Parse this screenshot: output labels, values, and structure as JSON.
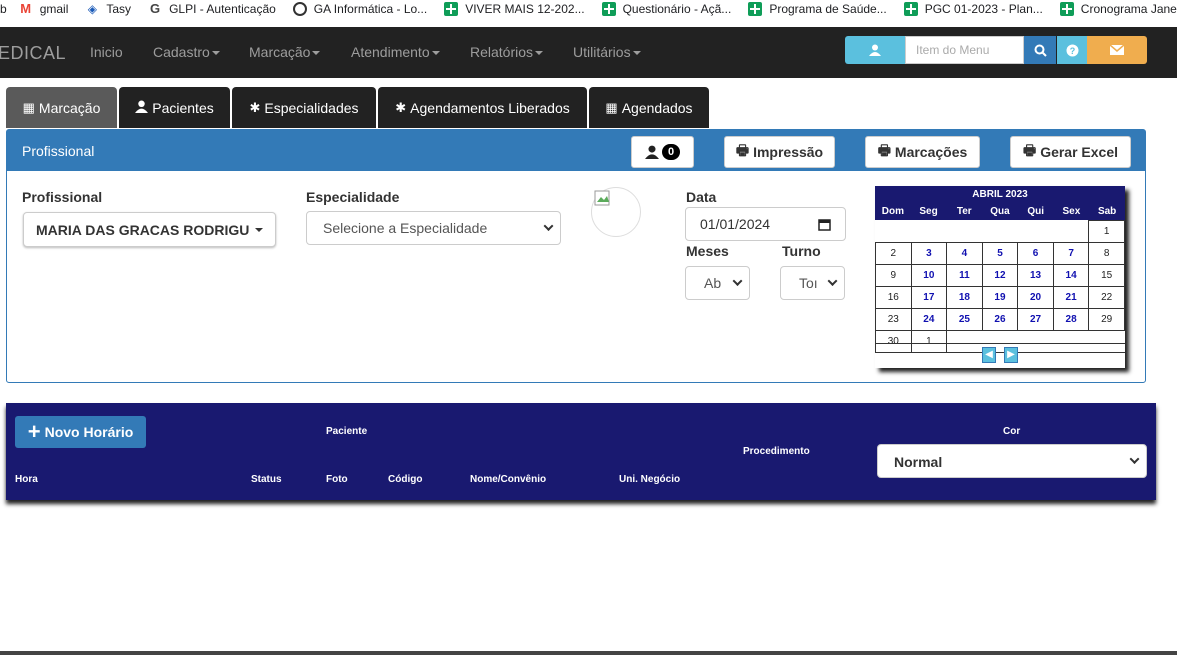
{
  "bookmarks": [
    {
      "label": "b",
      "icon": "none"
    },
    {
      "label": "gmail",
      "icon": "gmail-icon"
    },
    {
      "label": "Tasy",
      "icon": "tasy-icon"
    },
    {
      "label": "GLPI - Autenticação",
      "icon": "glpi-icon"
    },
    {
      "label": "GA Informática - Lo...",
      "icon": "globe-icon"
    },
    {
      "label": "VIVER MAIS 12-202...",
      "icon": "sheets-icon"
    },
    {
      "label": "Questionário - Açã...",
      "icon": "sheets-icon"
    },
    {
      "label": "Programa de Saúde...",
      "icon": "sheets-icon"
    },
    {
      "label": "PGC 01-2023 - Plan...",
      "icon": "sheets-icon"
    },
    {
      "label": "Cronograma Jane",
      "icon": "sheets-icon"
    }
  ],
  "navbar": {
    "brand": "EDICAL",
    "items": [
      "Inicio",
      "Cadastro",
      "Marcação",
      "Atendimento",
      "Relatórios",
      "Utilitários"
    ],
    "search_placeholder": "Item do Menu"
  },
  "tabs": [
    {
      "label": "Marcação",
      "icon": "calendar-icon",
      "active": true
    },
    {
      "label": "Pacientes",
      "icon": "user-icon",
      "active": false
    },
    {
      "label": "Especialidades",
      "icon": "asterisk-icon",
      "active": false
    },
    {
      "label": "Agendamentos Liberados",
      "icon": "asterisk-icon",
      "active": false
    },
    {
      "label": "Agendados",
      "icon": "calendar-icon",
      "active": false
    }
  ],
  "panel": {
    "title": "Profissional",
    "patients_count": "0",
    "print_label": "Impressão",
    "bookings_label": "Marcações",
    "excel_label": "Gerar Excel"
  },
  "form": {
    "professional_label": "Profissional",
    "professional_value": "MARIA DAS GRACAS RODRIGU",
    "specialty_label": "Especialidade",
    "specialty_value": "Selecione a Especialidade",
    "date_label": "Data",
    "date_value": "01/01/2024",
    "months_label": "Meses",
    "months_value": "Ab",
    "shift_label": "Turno",
    "shift_value": "Toı"
  },
  "calendar": {
    "title": "ABRIL 2023",
    "days": [
      "Dom",
      "Seg",
      "Ter",
      "Qua",
      "Qui",
      "Sex",
      "Sab"
    ],
    "weeks": [
      [
        "",
        "",
        "",
        "",
        "",
        "",
        "1"
      ],
      [
        "2",
        "3",
        "4",
        "5",
        "6",
        "7",
        "8"
      ],
      [
        "9",
        "10",
        "11",
        "12",
        "13",
        "14",
        "15"
      ],
      [
        "16",
        "17",
        "18",
        "19",
        "20",
        "21",
        "22"
      ],
      [
        "23",
        "24",
        "25",
        "26",
        "27",
        "28",
        "29"
      ],
      [
        "30",
        "1",
        "",
        "",
        "",
        "",
        ""
      ]
    ]
  },
  "schedule": {
    "new_button": "Novo Horário",
    "headers": {
      "paciente": "Paciente",
      "procedimento": "Procedimento",
      "cor": "Cor",
      "hora": "Hora",
      "status": "Status",
      "foto": "Foto",
      "codigo": "Código",
      "nome": "Nome/Convênio",
      "uni": "Uni. Negócio"
    },
    "color_value": "Normal"
  },
  "colors": {
    "navbar": "#222222",
    "primary": "#337ab7",
    "info": "#5bc0de",
    "warning": "#f0ad4e",
    "navy": "#191970"
  }
}
